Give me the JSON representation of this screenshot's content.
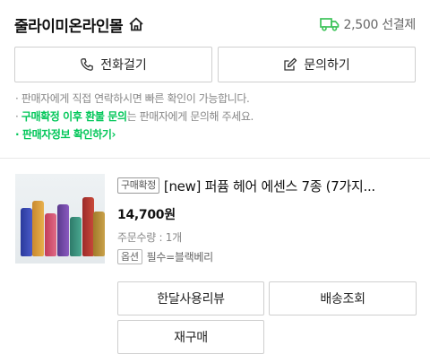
{
  "store": {
    "name": "줄라이미온라인몰",
    "home_icon": "home-icon"
  },
  "shipping": {
    "icon": "truck-icon",
    "text": "2,500 선결제",
    "icon_color": "#3ec35a"
  },
  "contact": {
    "call_label": "전화걸기",
    "inquiry_label": "문의하기"
  },
  "notices": {
    "line1": "· 판매자에게 직접 연락하시면 빠른 확인이 가능합니다.",
    "line2_bullet": "· ",
    "line2_highlight": "구매확정 이후 환불 문의",
    "line2_rest": "는 판매자에게 문의해 주세요.",
    "line3": "· 판매자정보 확인하기",
    "line3_chevron": "›"
  },
  "product": {
    "status_badge": "구매확정",
    "title": "[new] 퍼퓸 헤어 에센스 7종 (7가지...",
    "price": "14,700원",
    "quantity": "주문수량 : 1개",
    "option_badge": "옵션",
    "option_value": "필수=블랙베리"
  },
  "actions": {
    "review": "한달사용리뷰",
    "tracking": "배송조회",
    "reorder": "재구매"
  },
  "colors": {
    "accent": "#03c75a",
    "border": "#cfcfcf",
    "muted_text": "#888888"
  }
}
